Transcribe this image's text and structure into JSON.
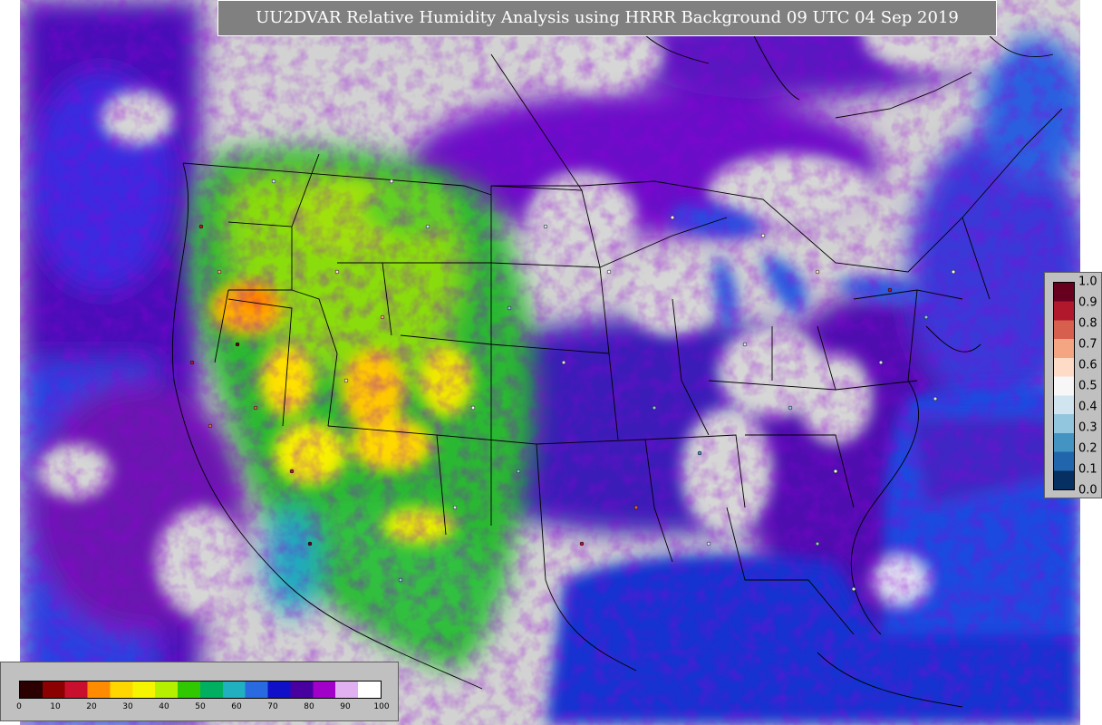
{
  "title": "UU2DVAR Relative Humidity Analysis using HRRR Background 09 UTC 04 Sep 2019",
  "rh_colorbar": {
    "ticks": [
      "0",
      "10",
      "20",
      "30",
      "40",
      "50",
      "60",
      "70",
      "80",
      "90",
      "100"
    ],
    "colors": [
      "#2a0000",
      "#8b0000",
      "#c8102e",
      "#ff8c00",
      "#ffd700",
      "#f5f500",
      "#b4f000",
      "#30c800",
      "#00b060",
      "#20b0c0",
      "#2a6ae0",
      "#1010c8",
      "#4800a0",
      "#a000c8",
      "#e0b0f0",
      "#ffffff"
    ]
  },
  "obs_colorbar": {
    "ticks": [
      "1.0",
      "0.9",
      "0.8",
      "0.7",
      "0.6",
      "0.5",
      "0.4",
      "0.3",
      "0.2",
      "0.1",
      "0.0"
    ],
    "colors": [
      "#67001f",
      "#b2182b",
      "#d6604d",
      "#f4a582",
      "#fddbc7",
      "#f7f7f7",
      "#d1e5f0",
      "#92c5de",
      "#4393c3",
      "#2166ac",
      "#053061"
    ]
  },
  "map_colors": {
    "background": "#d2d2d2",
    "ocean": "#1a3cd8",
    "dry_west": "#36c830",
    "very_dry": "#ffd000",
    "moist": "#5000b0",
    "saturated": "#d0d0d0"
  }
}
